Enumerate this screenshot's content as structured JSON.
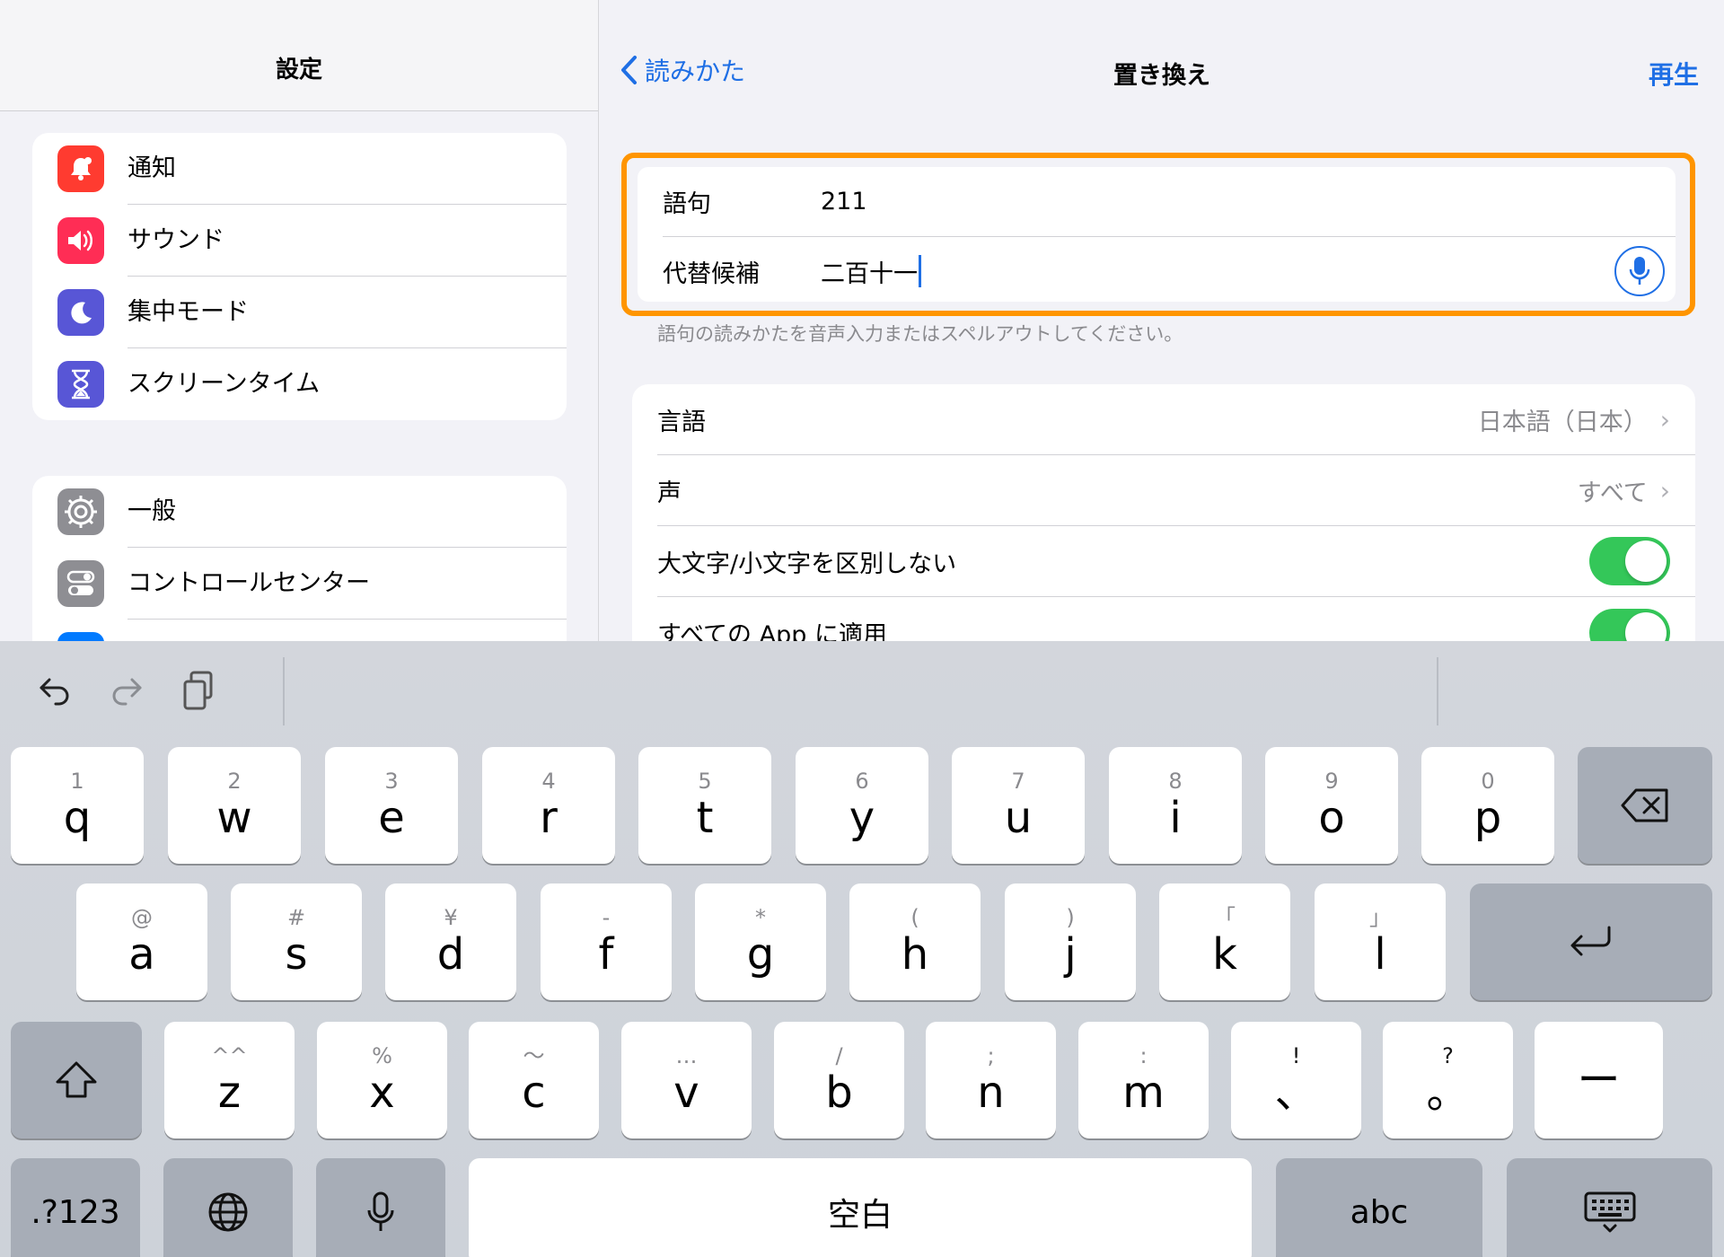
{
  "sidebar": {
    "title": "設定",
    "groups": [
      [
        {
          "label": "通知",
          "icon": "bell-icon",
          "color": "#ff3b30"
        },
        {
          "label": "サウンド",
          "icon": "speaker-icon",
          "color": "#ff2d55"
        },
        {
          "label": "集中モード",
          "icon": "moon-icon",
          "color": "#5856d6"
        },
        {
          "label": "スクリーンタイム",
          "icon": "hourglass-icon",
          "color": "#5856d6"
        }
      ],
      [
        {
          "label": "一般",
          "icon": "gear-icon",
          "color": "#8e8e93"
        },
        {
          "label": "コントロールセンター",
          "icon": "switches-icon",
          "color": "#8e8e93"
        },
        {
          "label": "",
          "icon": "display-icon",
          "color": "#007aff"
        }
      ]
    ]
  },
  "nav": {
    "back_label": "読みかた",
    "title": "置き換え",
    "play_label": "再生"
  },
  "form": {
    "phrase_label": "語句",
    "phrase_value": "211",
    "substitution_label": "代替候補",
    "substitution_value": "二百十一",
    "hint": "語句の読みかたを音声入力またはスペルアウトしてください。"
  },
  "settings": {
    "language_label": "言語",
    "language_value": "日本語（日本）",
    "voice_label": "声",
    "voice_value": "すべて",
    "ignore_case_label": "大文字/小文字を区別しない",
    "ignore_case_on": true,
    "apply_all_label": "すべての App に適用",
    "apply_all_on": true
  },
  "keyboard": {
    "row1": [
      {
        "main": "q",
        "sub": "1"
      },
      {
        "main": "w",
        "sub": "2"
      },
      {
        "main": "e",
        "sub": "3"
      },
      {
        "main": "r",
        "sub": "4"
      },
      {
        "main": "t",
        "sub": "5"
      },
      {
        "main": "y",
        "sub": "6"
      },
      {
        "main": "u",
        "sub": "7"
      },
      {
        "main": "i",
        "sub": "8"
      },
      {
        "main": "o",
        "sub": "9"
      },
      {
        "main": "p",
        "sub": "0"
      }
    ],
    "row2": [
      {
        "main": "a",
        "sub": "@"
      },
      {
        "main": "s",
        "sub": "#"
      },
      {
        "main": "d",
        "sub": "¥"
      },
      {
        "main": "f",
        "sub": "-"
      },
      {
        "main": "g",
        "sub": "*"
      },
      {
        "main": "h",
        "sub": "("
      },
      {
        "main": "j",
        "sub": ")"
      },
      {
        "main": "k",
        "sub": "「"
      },
      {
        "main": "l",
        "sub": "」"
      }
    ],
    "row3": [
      {
        "main": "z",
        "sub": "^^"
      },
      {
        "main": "x",
        "sub": "%"
      },
      {
        "main": "c",
        "sub": "〜"
      },
      {
        "main": "v",
        "sub": "…"
      },
      {
        "main": "b",
        "sub": "/"
      },
      {
        "main": "n",
        "sub": ";"
      },
      {
        "main": "m",
        "sub": ":"
      },
      {
        "main": "、",
        "sub": "!"
      },
      {
        "main": "。",
        "sub": "?"
      },
      {
        "main": "ー",
        "sub": ""
      }
    ],
    "numbers_label": ".?123",
    "space_label": "空白",
    "abc_label": "abc"
  }
}
